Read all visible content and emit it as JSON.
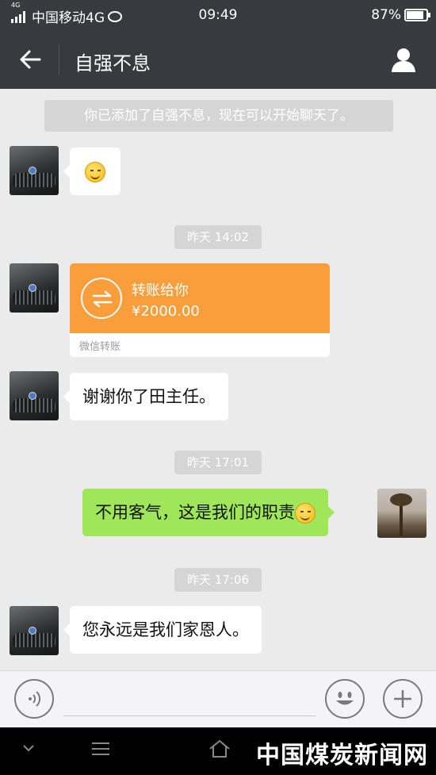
{
  "status_bar": {
    "network_label": "4G",
    "carrier": "中国移动4G",
    "weibo_icon": "weibo-icon",
    "time": "09:49",
    "battery_percent": "87%",
    "battery_level": 0.87
  },
  "header": {
    "back_icon": "back-arrow-icon",
    "title": "自强不息",
    "profile_icon": "person-icon"
  },
  "chat": {
    "system_notice": "你已添加了自强不息，现在可以开始聊天了。",
    "timestamps": [
      "昨天 14:02",
      "昨天 17:01",
      "昨天 17:06"
    ],
    "messages": [
      {
        "from": "contact",
        "type": "emoji",
        "emoji": "smile-emoji"
      },
      {
        "from": "contact",
        "type": "transfer",
        "title": "转账给你",
        "amount": "¥2000.00",
        "source": "微信转账"
      },
      {
        "from": "contact",
        "type": "text",
        "text": "谢谢你了田主任。"
      },
      {
        "from": "me",
        "type": "text",
        "text": "不用客气，这是我们的职责",
        "emoji": "smile-emoji"
      },
      {
        "from": "contact",
        "type": "text",
        "text": "您永远是我们家恩人。"
      }
    ]
  },
  "input_bar": {
    "voice_icon": "voice-icon",
    "emoji_icon": "emoji-icon",
    "plus_icon": "plus-icon"
  },
  "nav_bar": {
    "back_icon": "chevron-down-icon",
    "menu_icon": "menu-icon",
    "home_icon": "home-icon"
  },
  "watermark": "中国煤炭新闻网",
  "colors": {
    "header_bg": "#393a3f",
    "chat_bg": "#ebebeb",
    "my_bubble": "#9fe658",
    "transfer_orange": "#fa9d3b"
  }
}
